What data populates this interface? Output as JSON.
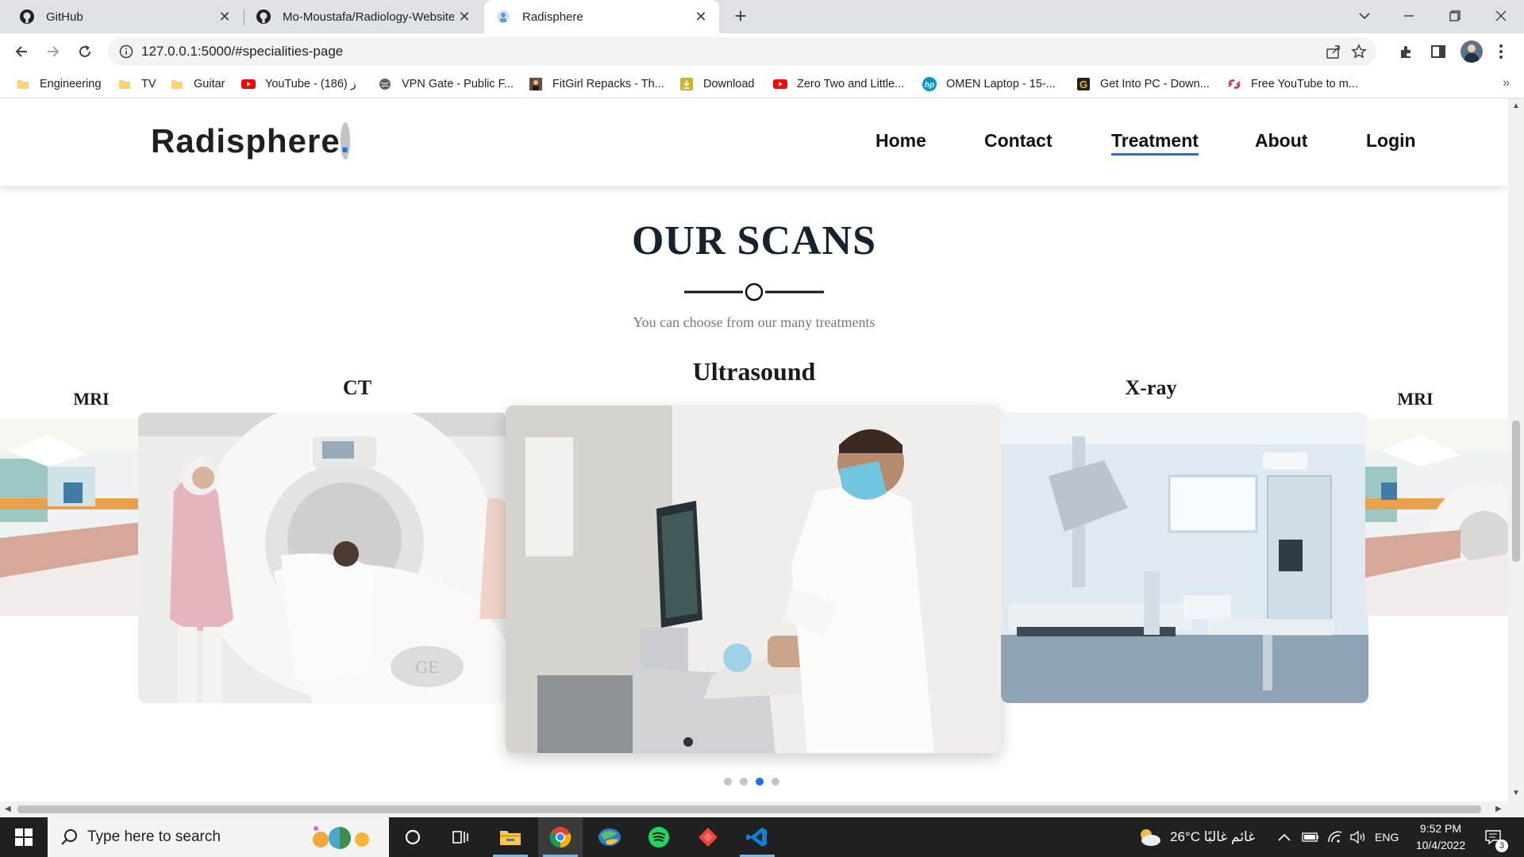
{
  "browser": {
    "tabs": [
      {
        "title": "GitHub",
        "icon": "github-icon",
        "active": false
      },
      {
        "title": "Mo-Moustafa/Radiology-Website",
        "icon": "github-icon",
        "active": false
      },
      {
        "title": "Radisphere",
        "icon": "radisphere-favicon",
        "active": true
      }
    ],
    "url": "127.0.0.1:5000/#specialities-page",
    "bookmarks": [
      {
        "label": "Engineering",
        "icon": "folder-icon"
      },
      {
        "label": "TV",
        "icon": "folder-icon"
      },
      {
        "label": "Guitar",
        "icon": "folder-icon"
      },
      {
        "label": "YouTube - ز (186)",
        "icon": "youtube-icon"
      },
      {
        "label": "VPN Gate - Public F...",
        "icon": "globe-icon"
      },
      {
        "label": "FitGirl Repacks - Th...",
        "icon": "fitgirl-icon"
      },
      {
        "label": "Download",
        "icon": "download-icon"
      },
      {
        "label": "Zero Two and Little...",
        "icon": "youtube-icon"
      },
      {
        "label": "OMEN Laptop - 15-...",
        "icon": "hp-icon"
      },
      {
        "label": "Get Into PC - Down...",
        "icon": "getintopc-icon"
      },
      {
        "label": "Free YouTube to m...",
        "icon": "ytmp3-icon"
      }
    ]
  },
  "site": {
    "brand": "Radisphere",
    "brand_dot": ".",
    "nav": [
      {
        "label": "Home",
        "active": false
      },
      {
        "label": "Contact",
        "active": false
      },
      {
        "label": "Treatment",
        "active": true
      },
      {
        "label": "About",
        "active": false
      },
      {
        "label": "Login",
        "active": false
      }
    ],
    "section_title": "OUR SCANS",
    "section_subtitle": "You can choose from our many treatments",
    "carousel": {
      "slides": [
        "MRI",
        "CT",
        "Ultrasound",
        "X-ray",
        "MRI"
      ],
      "active_slide": "Ultrasound",
      "dots": 4,
      "active_dot": 3
    }
  },
  "taskbar": {
    "search_placeholder": "Type here to search",
    "weather": "26°C  غائم غالبًا",
    "language": "ENG",
    "time": "9:52 PM",
    "date": "10/4/2022",
    "notifications": "3",
    "apps": [
      "cortana-icon",
      "task-view-icon",
      "file-explorer-icon",
      "chrome-icon",
      "earth-icon",
      "spotify-icon",
      "anydesk-icon",
      "vscode-icon"
    ]
  },
  "colors": {
    "accent": "#1a73e8",
    "heading": "#16222e",
    "taskbar": "#202020",
    "tabstrip": "#dee1e6"
  }
}
